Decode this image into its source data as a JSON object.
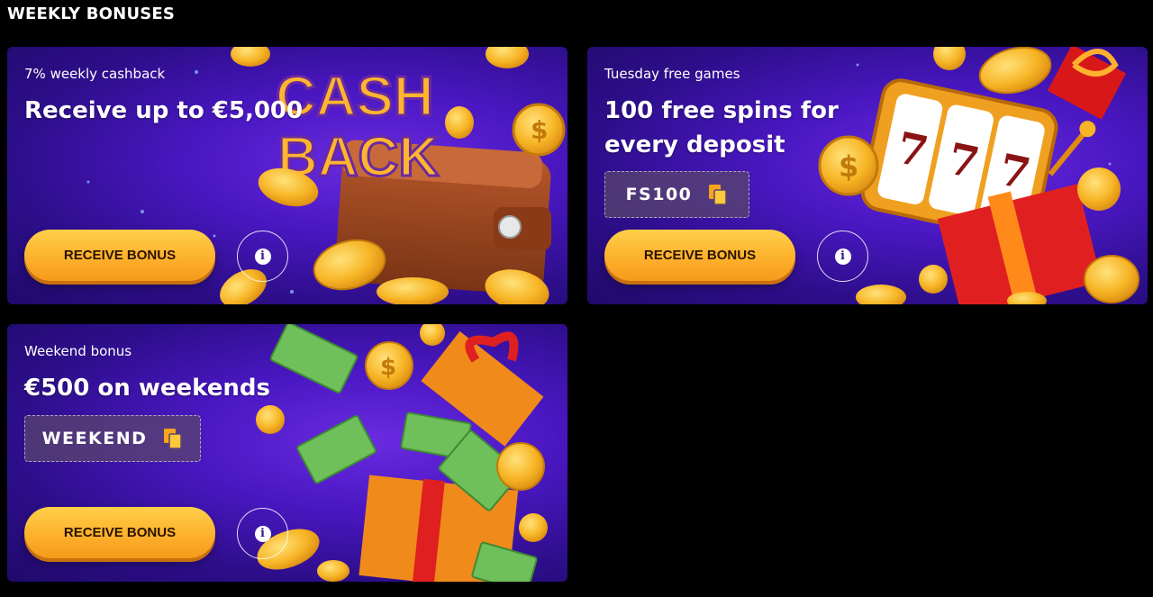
{
  "section": {
    "title": "WEEKLY BONUSES"
  },
  "cards": [
    {
      "subtitle": "7% weekly cashback",
      "headline": "Receive up to €5,000",
      "art_text": [
        "CASH",
        "BACK"
      ],
      "button_label": "RECEIVE BONUS"
    },
    {
      "subtitle": "Tuesday free games",
      "headline": "100 free spins for every deposit",
      "promo_code": "FS100",
      "slot_symbols": [
        "7",
        "7",
        "7"
      ],
      "button_label": "RECEIVE BONUS"
    },
    {
      "subtitle": "Weekend bonus",
      "headline": "€500 on weekends",
      "promo_code": "WEEKEND",
      "button_label": "RECEIVE BONUS"
    }
  ],
  "icons": {
    "info": "info-icon",
    "copy": "copy-icon",
    "coin": "coin-icon"
  },
  "colors": {
    "button": "#fdb12c",
    "card_bg": "#4a17c2",
    "page_bg": "#000000"
  }
}
